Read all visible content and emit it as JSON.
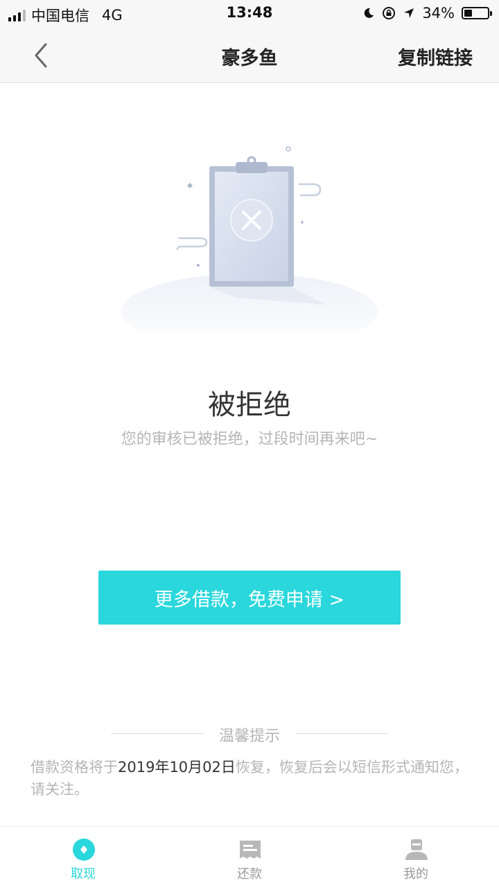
{
  "status_bar": {
    "carrier": "中国电信",
    "network": "4G",
    "time": "13:48",
    "battery": "34%",
    "battery_level": 0.34
  },
  "nav": {
    "back_icon": "chevron-left-icon",
    "title": "豪多鱼",
    "action_label": "复制链接"
  },
  "result": {
    "icon": "rejected-clipboard-illustration",
    "title": "被拒绝",
    "description": "您的审核已被拒绝，过段时间再来吧~"
  },
  "apply_button": {
    "label": "更多借款，免费申请 >"
  },
  "tips": {
    "title": "温馨提示",
    "text_prefix": "借款资格将于",
    "date": "2019年10月02日",
    "text_suffix": "恢复，恢复后会以短信形式通知您，请关注。"
  },
  "tab_bar": {
    "items": [
      {
        "label": "取现",
        "icon": "cash-icon",
        "active": true
      },
      {
        "label": "还款",
        "icon": "bill-icon",
        "active": false
      },
      {
        "label": "我的",
        "icon": "user-icon",
        "active": false
      }
    ]
  },
  "colors": {
    "accent": "#2ad7dc",
    "muted_text": "#b5b5b5",
    "nav_background": "#f7f7f7"
  }
}
